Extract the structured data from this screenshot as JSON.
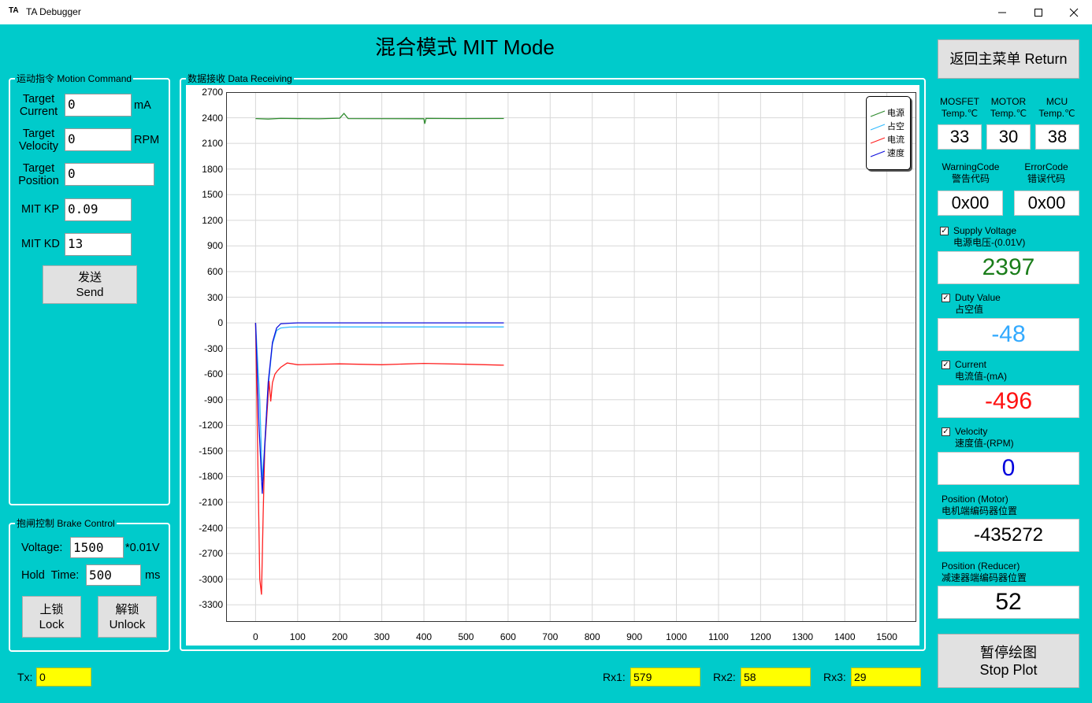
{
  "window": {
    "logo": "TA",
    "title": "TA Debugger"
  },
  "page_title": "混合模式 MIT Mode",
  "motion": {
    "title": "运动指令 Motion Command",
    "target_current_label_1": "Target",
    "target_current_label_2": "Current",
    "target_current_value": "0",
    "target_current_unit": "mA",
    "target_velocity_label_1": "Target",
    "target_velocity_label_2": "Velocity",
    "target_velocity_value": "0",
    "target_velocity_unit": "RPM",
    "target_position_label_1": "Target",
    "target_position_label_2": "Position",
    "target_position_value": "0",
    "mit_kp_label": "MIT KP",
    "mit_kp_value": "0.09",
    "mit_kd_label": "MIT KD",
    "mit_kd_value": "13",
    "send_label_cn": "发送",
    "send_label_en": "Send"
  },
  "brake": {
    "title": "抱闸控制 Brake Control",
    "voltage_label": "Voltage:",
    "voltage_value": "1500",
    "voltage_unit": "*0.01V",
    "hold_label": "Hold  Time:",
    "hold_value": "500",
    "hold_unit": "ms",
    "lock_cn": "上锁",
    "lock_en": "Lock",
    "unlock_cn": "解锁",
    "unlock_en": "Unlock"
  },
  "receiving": {
    "title": "数据接收 Data Receiving"
  },
  "chart_data": {
    "type": "line",
    "xlim": [
      -70,
      1570
    ],
    "ylim": [
      -3500,
      2700
    ],
    "x_ticks": [
      "0",
      "100",
      "200",
      "300",
      "400",
      "500",
      "600",
      "700",
      "800",
      "900",
      "1000",
      "1100",
      "1200",
      "1300",
      "1400",
      "1500"
    ],
    "y_ticks": [
      "2700",
      "2400",
      "2100",
      "1800",
      "1500",
      "1200",
      "900",
      "600",
      "300",
      "0",
      "-300",
      "-600",
      "-900",
      "-1200",
      "-1500",
      "-1800",
      "-2100",
      "-2400",
      "-2700",
      "-3000",
      "-3300"
    ],
    "grid": true,
    "legend_position": "top-right",
    "series": [
      {
        "name": "电源",
        "color": "#2e8b2e",
        "points": [
          [
            0,
            2390
          ],
          [
            30,
            2385
          ],
          [
            60,
            2392
          ],
          [
            150,
            2388
          ],
          [
            200,
            2395
          ],
          [
            210,
            2450
          ],
          [
            220,
            2390
          ],
          [
            400,
            2389
          ],
          [
            402,
            2330
          ],
          [
            405,
            2392
          ],
          [
            480,
            2390
          ],
          [
            590,
            2391
          ]
        ]
      },
      {
        "name": "占空",
        "color": "#33bbff",
        "points": [
          [
            0,
            0
          ],
          [
            10,
            -900
          ],
          [
            16,
            -1850
          ],
          [
            20,
            -1550
          ],
          [
            30,
            -750
          ],
          [
            40,
            -250
          ],
          [
            50,
            -90
          ],
          [
            60,
            -60
          ],
          [
            80,
            -50
          ],
          [
            100,
            -48
          ],
          [
            300,
            -48
          ],
          [
            590,
            -48
          ]
        ]
      },
      {
        "name": "电流",
        "color": "#ff2020",
        "points": [
          [
            0,
            0
          ],
          [
            6,
            -1800
          ],
          [
            10,
            -3000
          ],
          [
            14,
            -3180
          ],
          [
            18,
            -2250
          ],
          [
            22,
            -1450
          ],
          [
            28,
            -1000
          ],
          [
            32,
            -680
          ],
          [
            36,
            -920
          ],
          [
            40,
            -700
          ],
          [
            46,
            -600
          ],
          [
            52,
            -560
          ],
          [
            60,
            -520
          ],
          [
            75,
            -470
          ],
          [
            100,
            -490
          ],
          [
            200,
            -480
          ],
          [
            300,
            -490
          ],
          [
            400,
            -475
          ],
          [
            500,
            -485
          ],
          [
            590,
            -496
          ]
        ]
      },
      {
        "name": "速度",
        "color": "#1010dd",
        "points": [
          [
            0,
            0
          ],
          [
            8,
            -1200
          ],
          [
            16,
            -2000
          ],
          [
            20,
            -1600
          ],
          [
            30,
            -700
          ],
          [
            40,
            -230
          ],
          [
            50,
            -60
          ],
          [
            60,
            -10
          ],
          [
            80,
            -5
          ],
          [
            100,
            0
          ],
          [
            590,
            0
          ]
        ]
      }
    ]
  },
  "temps": {
    "mosfet_1": "MOSFET",
    "mosfet_2": "Temp.℃",
    "mosfet_value": "33",
    "motor_1": "MOTOR",
    "motor_2": "Temp.℃",
    "motor_value": "30",
    "mcu_1": "MCU",
    "mcu_2": "Temp.℃",
    "mcu_value": "38"
  },
  "codes": {
    "warning_1": "WarningCode",
    "warning_2": "警告代码",
    "warning_value": "0x00",
    "error_1": "ErrorCode",
    "error_2": "错误代码",
    "error_value": "0x00"
  },
  "readouts": {
    "return_label": "返回主菜单 Return",
    "supply_1": "Supply Voltage",
    "supply_2": "电源电压-(0.01V)",
    "supply_value": "2397",
    "supply_color": "#1a7d1a",
    "duty_1": "Duty Value",
    "duty_2": "占空值",
    "duty_value": "-48",
    "duty_color": "#33aaff",
    "current_1": "Current",
    "current_2": "电流值-(mA)",
    "current_value": "-496",
    "current_color": "#ff1010",
    "velocity_1": "Velocity",
    "velocity_2": "速度值-(RPM)",
    "velocity_value": "0",
    "velocity_color": "#0000dd",
    "pos_motor_1": "Position (Motor)",
    "pos_motor_2": "电机端编码器位置",
    "pos_motor_value": "-435272",
    "pos_reducer_1": "Position (Reducer)",
    "pos_reducer_2": "减速器端编码器位置",
    "pos_reducer_value": "52",
    "stop_cn": "暂停绘图",
    "stop_en": "Stop Plot",
    "checked": "✓"
  },
  "status": {
    "tx_label": "Tx:",
    "tx_value": "0",
    "rx1_label": "Rx1:",
    "rx1_value": "579",
    "rx2_label": "Rx2:",
    "rx2_value": "58",
    "rx3_label": "Rx3:",
    "rx3_value": "29"
  }
}
